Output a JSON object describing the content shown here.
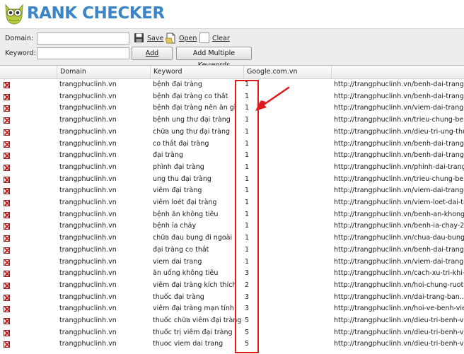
{
  "app": {
    "logo_text": "RANK CHECKER"
  },
  "toolbar": {
    "domain_label": "Domain:",
    "domain_value": "",
    "keyword_label": "Keyword:",
    "keyword_value": "",
    "save_label": "Save",
    "open_label": "Open",
    "clear_label": "Clear",
    "add_label": "Add",
    "add_multiple_label": "Add Multiple Keywords"
  },
  "table": {
    "columns": [
      "Domain",
      "Keyword",
      "Google.com.vn"
    ],
    "rows": [
      {
        "domain": "trangphuclinh.vn",
        "keyword": "bệnh đại tràng",
        "rank": "1",
        "url": "http://trangphuclinh.vn/benh-dai-trang/"
      },
      {
        "domain": "trangphuclinh.vn",
        "keyword": "bệnh đại tràng co thắt",
        "rank": "1",
        "url": "http://trangphuclinh.vn/benh-dai-trang-co-t..."
      },
      {
        "domain": "trangphuclinh.vn",
        "keyword": "bệnh đại tràng nên ăn gì",
        "rank": "1",
        "url": "http://trangphuclinh.vn/viem-dai-trang-an-g"
      },
      {
        "domain": "trangphuclinh.vn",
        "keyword": "bệnh ung thư đại tràng",
        "rank": "1",
        "url": "http://trangphuclinh.vn/trieu-chung-benh-u..."
      },
      {
        "domain": "trangphuclinh.vn",
        "keyword": "chữa ung thư đại tràng",
        "rank": "1",
        "url": "http://trangphuclinh.vn/dieu-tri-ung-thu-dai"
      },
      {
        "domain": "trangphuclinh.vn",
        "keyword": "co thắt đại tràng",
        "rank": "1",
        "url": "http://trangphuclinh.vn/benh-dai-trang-co-t..."
      },
      {
        "domain": "trangphuclinh.vn",
        "keyword": "đại tràng",
        "rank": "1",
        "url": "http://trangphuclinh.vn/benh-dai-trang/"
      },
      {
        "domain": "trangphuclinh.vn",
        "keyword": "phình đại tràng",
        "rank": "1",
        "url": "http://trangphuclinh.vn/phinh-dai-trang-ba..."
      },
      {
        "domain": "trangphuclinh.vn",
        "keyword": "ung thu đại tràng",
        "rank": "1",
        "url": "http://trangphuclinh.vn/trieu-chung-benh-u..."
      },
      {
        "domain": "trangphuclinh.vn",
        "keyword": "viêm đại tràng",
        "rank": "1",
        "url": "http://trangphuclinh.vn/viem-dai-trang-la-gi"
      },
      {
        "domain": "trangphuclinh.vn",
        "keyword": "viêm loét đại tràng",
        "rank": "1",
        "url": "http://trangphuclinh.vn/viem-loet-dai-trang-..."
      },
      {
        "domain": "trangphuclinh.vn",
        "keyword": "bệnh ăn không tiêu",
        "rank": "1",
        "url": "http://trangphuclinh.vn/benh-an-khong-tieu"
      },
      {
        "domain": "trangphuclinh.vn",
        "keyword": "bệnh ỉa chảy",
        "rank": "1",
        "url": "http://trangphuclinh.vn/benh-ia-chay-2819/"
      },
      {
        "domain": "trangphuclinh.vn",
        "keyword": "chữa đau bụng đi ngoài",
        "rank": "1",
        "url": "http://trangphuclinh.vn/chua-dau-bung-di-..."
      },
      {
        "domain": "trangphuclinh.vn",
        "keyword": "đại tràng co thắt",
        "rank": "1",
        "url": "http://trangphuclinh.vn/benh-dai-trang-co-t..."
      },
      {
        "domain": "trangphuclinh.vn",
        "keyword": "viem dai trang",
        "rank": "1",
        "url": "http://trangphuclinh.vn/viem-dai-trang-la-gi"
      },
      {
        "domain": "trangphuclinh.vn",
        "keyword": "ăn uống không tiêu",
        "rank": "3",
        "url": "http://trangphuclinh.vn/cach-xu-tri-khi-an-..."
      },
      {
        "domain": "trangphuclinh.vn",
        "keyword": "viêm đại tràng kích thích",
        "rank": "2",
        "url": "http://trangphuclinh.vn/hoi-chung-ruot-kich"
      },
      {
        "domain": "trangphuclinh.vn",
        "keyword": "thuốc đại tràng",
        "rank": "3",
        "url": "http://trangphuclinh.vn/dai-trang-ban..."
      },
      {
        "domain": "trangphuclinh.vn",
        "keyword": "viêm đại tràng mạn tính",
        "rank": "3",
        "url": "http://trangphuclinh.vn/hoi-ve-benh-viem-dai"
      },
      {
        "domain": "trangphuclinh.vn",
        "keyword": "thuốc chữa viêm đại tràng",
        "rank": "5",
        "url": "http://trangphuclinh.vn/dieu-tri-benh-viem-..."
      },
      {
        "domain": "trangphuclinh.vn",
        "keyword": "thuốc trị viêm đại tràng",
        "rank": "5",
        "url": "http://trangphuclinh.vn/dieu-tri-benh-viem-..."
      },
      {
        "domain": "trangphuclinh.vn",
        "keyword": "thuoc viem dai trang",
        "rank": "5",
        "url": "http://trangphuclinh.vn/dieu-tri-benh-viem-..."
      }
    ]
  },
  "annotation": {
    "color": "#e01a1a"
  }
}
